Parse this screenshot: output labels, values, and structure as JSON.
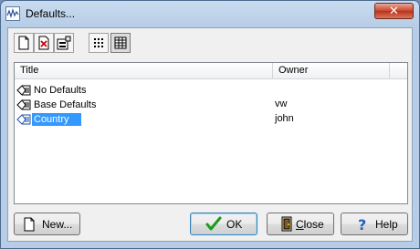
{
  "window": {
    "title": "Defaults..."
  },
  "titlebar": {
    "close_symbol": "✕"
  },
  "toolbar": {
    "buttons": [
      {
        "name": "new-document-icon"
      },
      {
        "name": "delete-document-icon"
      },
      {
        "name": "properties-icon"
      },
      {
        "name": "large-icons-view-icon"
      },
      {
        "name": "details-view-icon",
        "pressed": true
      }
    ]
  },
  "list": {
    "columns": [
      "Title",
      "Owner"
    ],
    "rows": [
      {
        "title": "No Defaults",
        "owner": ""
      },
      {
        "title": "Base Defaults",
        "owner": "vw"
      },
      {
        "title": "Country",
        "owner": "john",
        "selected": true
      }
    ]
  },
  "buttons": {
    "new": "New...",
    "ok": "OK",
    "close_first": "C",
    "close_rest": "lose",
    "help": "Help"
  },
  "colors": {
    "selection": "#3399ff",
    "ok_check": "#1a9b1a",
    "help_icon": "#1f5fc7"
  }
}
